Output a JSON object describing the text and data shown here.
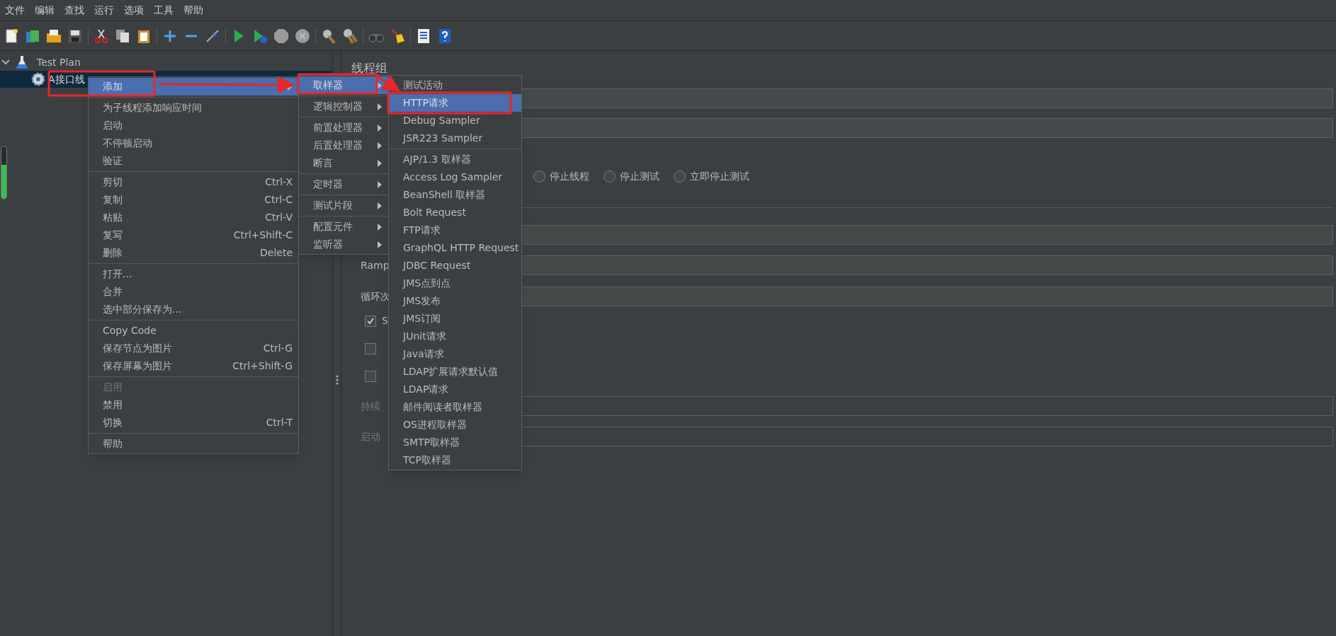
{
  "menu_bar": [
    "文件",
    "编辑",
    "查找",
    "运行",
    "选项",
    "工具",
    "帮助"
  ],
  "tree": [
    {
      "label": "Test Plan",
      "expanded": true,
      "selected": false,
      "children": [
        {
          "label": "A接口线",
          "selected": true
        }
      ]
    }
  ],
  "context_menu": [
    [
      {
        "label": "添加",
        "submenu": true,
        "selected": true,
        "disabled": false
      }
    ],
    [
      {
        "label": "为子线程添加响应时间",
        "submenu": false,
        "selected": false,
        "disabled": false
      },
      {
        "label": "启动",
        "submenu": false,
        "selected": false,
        "disabled": false
      },
      {
        "label": "不停顿启动",
        "submenu": false,
        "selected": false,
        "disabled": false
      },
      {
        "label": "验证",
        "submenu": false,
        "selected": false,
        "disabled": false
      }
    ],
    [
      {
        "label": "剪切",
        "shortcut": "Ctrl-X",
        "submenu": false,
        "selected": false,
        "disabled": false
      },
      {
        "label": "复制",
        "shortcut": "Ctrl-C",
        "submenu": false,
        "selected": false,
        "disabled": false
      },
      {
        "label": "粘贴",
        "shortcut": "Ctrl-V",
        "submenu": false,
        "selected": false,
        "disabled": false
      },
      {
        "label": "复写",
        "shortcut": "Ctrl+Shift-C",
        "submenu": false,
        "selected": false,
        "disabled": false
      },
      {
        "label": "删除",
        "shortcut": "Delete",
        "submenu": false,
        "selected": false,
        "disabled": false
      }
    ],
    [
      {
        "label": "打开...",
        "submenu": false,
        "selected": false,
        "disabled": false
      },
      {
        "label": "合并",
        "submenu": false,
        "selected": false,
        "disabled": false
      },
      {
        "label": "选中部分保存为...",
        "submenu": false,
        "selected": false,
        "disabled": false
      }
    ],
    [
      {
        "label": "Copy Code",
        "submenu": false,
        "selected": false,
        "disabled": false
      },
      {
        "label": "保存节点为图片",
        "shortcut": "Ctrl-G",
        "submenu": false,
        "selected": false,
        "disabled": false
      },
      {
        "label": "保存屏幕为图片",
        "shortcut": "Ctrl+Shift-G",
        "submenu": false,
        "selected": false,
        "disabled": false
      }
    ],
    [
      {
        "label": "启用",
        "submenu": false,
        "selected": false,
        "disabled": true
      },
      {
        "label": "禁用",
        "submenu": false,
        "selected": false,
        "disabled": false
      },
      {
        "label": "切换",
        "shortcut": "Ctrl-T",
        "submenu": false,
        "selected": false,
        "disabled": false
      }
    ],
    [
      {
        "label": "帮助",
        "submenu": false,
        "selected": false,
        "disabled": false
      }
    ]
  ],
  "add_submenu": [
    [
      {
        "label": "取样器",
        "selected": true
      }
    ],
    [
      {
        "label": "逻辑控制器",
        "selected": false
      }
    ],
    [
      {
        "label": "前置处理器",
        "selected": false
      },
      {
        "label": "后置处理器",
        "selected": false
      },
      {
        "label": "断言",
        "selected": false
      }
    ],
    [
      {
        "label": "定时器",
        "selected": false
      }
    ],
    [
      {
        "label": "测试片段",
        "selected": false
      }
    ],
    [
      {
        "label": "配置元件",
        "selected": false
      },
      {
        "label": "监听器",
        "selected": false
      }
    ]
  ],
  "sampler_submenu": [
    [
      {
        "label": "测试活动",
        "selected": false
      },
      {
        "label": "HTTP请求",
        "selected": true
      },
      {
        "label": "Debug Sampler",
        "selected": false
      },
      {
        "label": "JSR223 Sampler",
        "selected": false
      }
    ],
    [
      {
        "label": "AJP/1.3 取样器",
        "selected": false
      },
      {
        "label": "Access Log Sampler",
        "selected": false
      },
      {
        "label": "BeanShell 取样器",
        "selected": false
      },
      {
        "label": "Bolt Request",
        "selected": false
      },
      {
        "label": "FTP请求",
        "selected": false
      },
      {
        "label": "GraphQL HTTP Request",
        "selected": false
      },
      {
        "label": "JDBC Request",
        "selected": false
      },
      {
        "label": "JMS点到点",
        "selected": false
      },
      {
        "label": "JMS发布",
        "selected": false
      },
      {
        "label": "JMS订阅",
        "selected": false
      },
      {
        "label": "JUnit请求",
        "selected": false
      },
      {
        "label": "Java请求",
        "selected": false
      },
      {
        "label": "LDAP扩展请求默认值",
        "selected": false
      },
      {
        "label": "LDAP请求",
        "selected": false
      },
      {
        "label": "邮件阅读者取样器",
        "selected": false
      },
      {
        "label": "OS进程取样器",
        "selected": false
      },
      {
        "label": "SMTP取样器",
        "selected": false
      },
      {
        "label": "TCP取样器",
        "selected": false
      }
    ]
  ],
  "panel": {
    "title": "线程组",
    "on_error": [
      {
        "label": "停止线程",
        "selected": false
      },
      {
        "label": "停止测试",
        "selected": false
      },
      {
        "label": "立即停止测试",
        "selected": false
      }
    ],
    "ramp_label": "Ramp",
    "loop_label": "循环次",
    "checkboxes": [
      {
        "label": "S",
        "checked": true
      },
      {
        "checked": false
      },
      {
        "checked": false
      }
    ],
    "duration": {
      "label": "持续",
      "disabled": true
    },
    "delay": {
      "label": "启动",
      "disabled": true
    }
  }
}
